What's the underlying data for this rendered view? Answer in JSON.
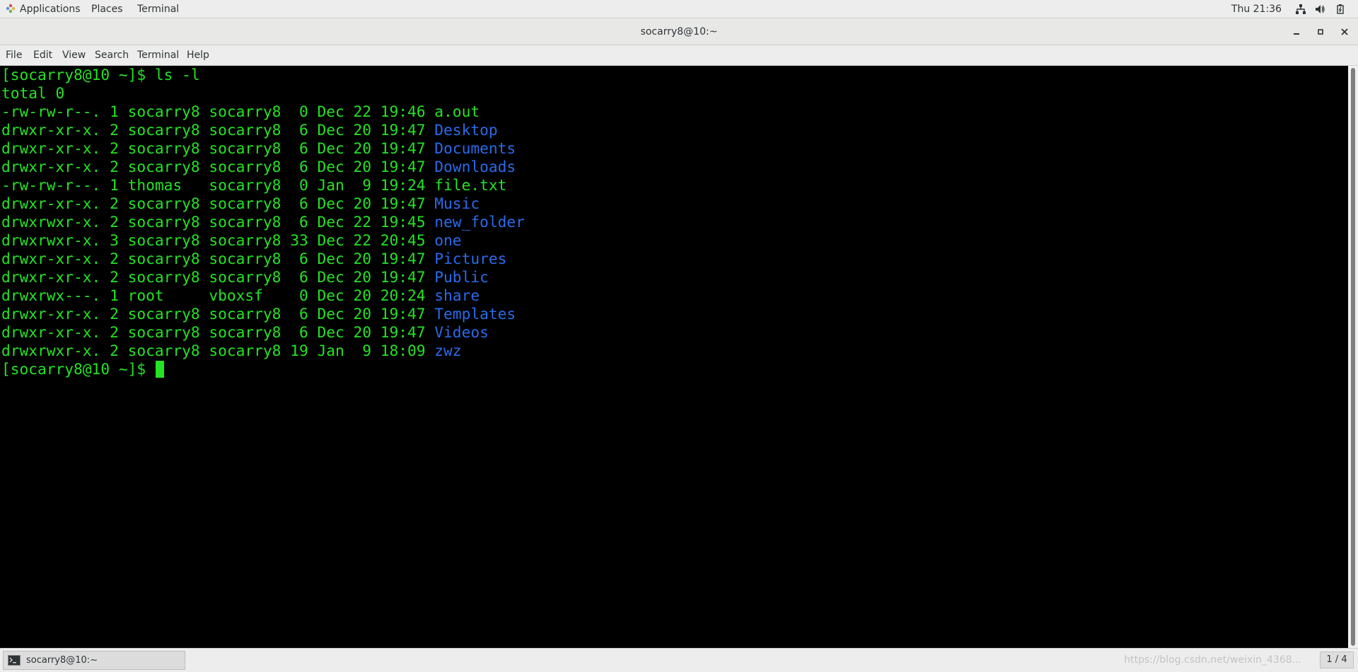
{
  "topbar": {
    "applications": "Applications",
    "places": "Places",
    "terminal": "Terminal",
    "clock": "Thu 21:36",
    "icons": [
      "network-icon",
      "volume-icon",
      "battery-icon"
    ]
  },
  "window": {
    "title": "socarry8@10:~",
    "buttons": [
      "minimize-icon",
      "maximize-icon",
      "close-icon"
    ]
  },
  "menubar": {
    "items": [
      "File",
      "Edit",
      "View",
      "Search",
      "Terminal",
      "Help"
    ]
  },
  "colors": {
    "terminal_bg": "#000000",
    "terminal_fg": "#25e225",
    "directory_name": "#2a6bea"
  },
  "terminal": {
    "prompt": "[socarry8@10 ~]$ ",
    "command": "ls -l",
    "total": "total 0",
    "listing": [
      {
        "meta": "-rw-rw-r--. 1 socarry8 socarry8  0 Dec 22 19:46 ",
        "name": "a.out",
        "is_dir": false
      },
      {
        "meta": "drwxr-xr-x. 2 socarry8 socarry8  6 Dec 20 19:47 ",
        "name": "Desktop",
        "is_dir": true
      },
      {
        "meta": "drwxr-xr-x. 2 socarry8 socarry8  6 Dec 20 19:47 ",
        "name": "Documents",
        "is_dir": true
      },
      {
        "meta": "drwxr-xr-x. 2 socarry8 socarry8  6 Dec 20 19:47 ",
        "name": "Downloads",
        "is_dir": true
      },
      {
        "meta": "-rw-rw-r--. 1 thomas   socarry8  0 Jan  9 19:24 ",
        "name": "file.txt",
        "is_dir": false
      },
      {
        "meta": "drwxr-xr-x. 2 socarry8 socarry8  6 Dec 20 19:47 ",
        "name": "Music",
        "is_dir": true
      },
      {
        "meta": "drwxrwxr-x. 2 socarry8 socarry8  6 Dec 22 19:45 ",
        "name": "new_folder",
        "is_dir": true
      },
      {
        "meta": "drwxrwxr-x. 3 socarry8 socarry8 33 Dec 22 20:45 ",
        "name": "one",
        "is_dir": true
      },
      {
        "meta": "drwxr-xr-x. 2 socarry8 socarry8  6 Dec 20 19:47 ",
        "name": "Pictures",
        "is_dir": true
      },
      {
        "meta": "drwxr-xr-x. 2 socarry8 socarry8  6 Dec 20 19:47 ",
        "name": "Public",
        "is_dir": true
      },
      {
        "meta": "drwxrwx---. 1 root     vboxsf    0 Dec 20 20:24 ",
        "name": "share",
        "is_dir": true
      },
      {
        "meta": "drwxr-xr-x. 2 socarry8 socarry8  6 Dec 20 19:47 ",
        "name": "Templates",
        "is_dir": true
      },
      {
        "meta": "drwxr-xr-x. 2 socarry8 socarry8  6 Dec 20 19:47 ",
        "name": "Videos",
        "is_dir": true
      },
      {
        "meta": "drwxrwxr-x. 2 socarry8 socarry8 19 Jan  9 18:09 ",
        "name": "zwz",
        "is_dir": true
      }
    ]
  },
  "taskbar": {
    "task_label": "socarry8@10:~",
    "watermark": "https://blog.csdn.net/weixin_4368...",
    "workspace": "1 / 4"
  }
}
